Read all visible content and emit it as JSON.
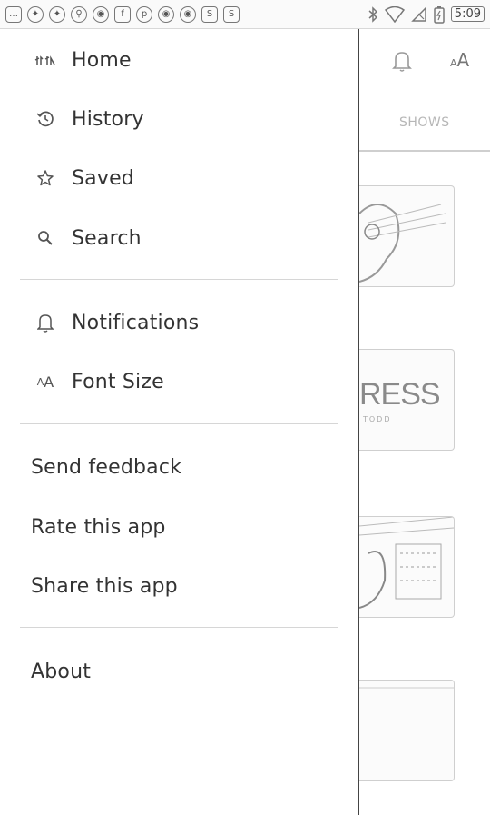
{
  "status_bar": {
    "left_icons": [
      "message-icon",
      "bird-icon",
      "bird-icon",
      "tools-icon",
      "app-icon",
      "facebook-icon",
      "pinterest-icon",
      "app-icon",
      "app-icon",
      "s-icon",
      "s-icon"
    ],
    "time": "5:09"
  },
  "drawer": {
    "nav": [
      {
        "label": "Home",
        "icon": "home-icon"
      },
      {
        "label": "History",
        "icon": "history-icon"
      },
      {
        "label": "Saved",
        "icon": "star-icon"
      },
      {
        "label": "Search",
        "icon": "search-icon"
      }
    ],
    "settings": [
      {
        "label": "Notifications",
        "icon": "bell-icon"
      },
      {
        "label": "Font Size",
        "icon": "font-size-icon"
      }
    ],
    "actions": [
      {
        "label": "Send feedback"
      },
      {
        "label": "Rate this app"
      },
      {
        "label": "Share this app"
      }
    ],
    "about": {
      "label": "About"
    }
  },
  "background": {
    "font_icon_label": "A",
    "font_icon_small": "A",
    "tab_shows": "SHOWS",
    "press_text": "RESS",
    "press_sub": "TODD"
  }
}
